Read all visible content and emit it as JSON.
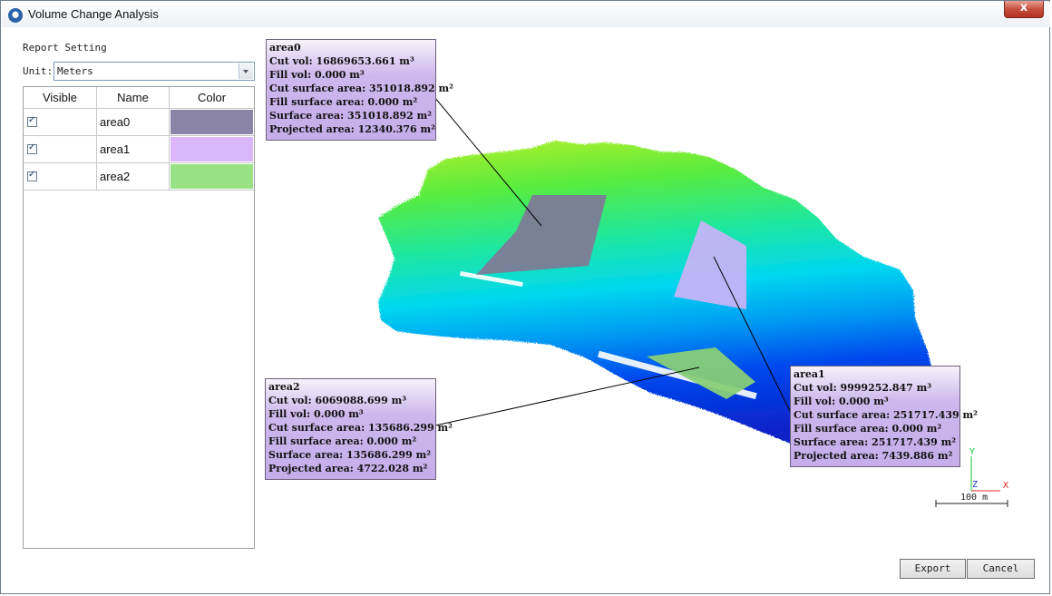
{
  "window": {
    "title": "Volume Change Analysis",
    "close_glyph": "x"
  },
  "report": {
    "heading": "Report Setting",
    "unit_label": "Unit:",
    "unit_value": "Meters"
  },
  "table": {
    "headers": {
      "visible": "Visible",
      "name": "Name",
      "color": "Color"
    },
    "rows": [
      {
        "name": "area0",
        "color": "#8a84a6",
        "visible": true
      },
      {
        "name": "area1",
        "color": "#dcb6fb",
        "visible": true
      },
      {
        "name": "area2",
        "color": "#98e184",
        "visible": true
      }
    ]
  },
  "panels": {
    "area0": {
      "name": "area0",
      "cut_vol": "Cut vol: 16869653.661 m³",
      "fill_vol": "Fill vol: 0.000 m³",
      "cut_surface": "Cut surface area: 351018.892 m²",
      "fill_surface": "Fill surface area: 0.000 m²",
      "surface": "Surface area: 351018.892 m²",
      "projected": "Projected area: 12340.376 m²"
    },
    "area1": {
      "name": "area1",
      "cut_vol": "Cut vol: 9999252.847 m³",
      "fill_vol": "Fill vol: 0.000 m³",
      "cut_surface": "Cut surface area: 251717.439 m²",
      "fill_surface": "Fill surface area: 0.000 m²",
      "surface": "Surface area: 251717.439 m²",
      "projected": "Projected area: 7439.886 m²"
    },
    "area2": {
      "name": "area2",
      "cut_vol": "Cut vol: 6069088.699 m³",
      "fill_vol": "Fill vol: 0.000 m³",
      "cut_surface": "Cut surface area: 135686.299 m²",
      "fill_surface": "Fill surface area: 0.000 m²",
      "surface": "Surface area: 135686.299 m²",
      "projected": "Projected area: 4722.028 m²"
    }
  },
  "axes": {
    "y": "Y",
    "z": "Z",
    "x": "X",
    "scale": "100 m"
  },
  "buttons": {
    "export": "Export",
    "cancel": "Cancel"
  }
}
